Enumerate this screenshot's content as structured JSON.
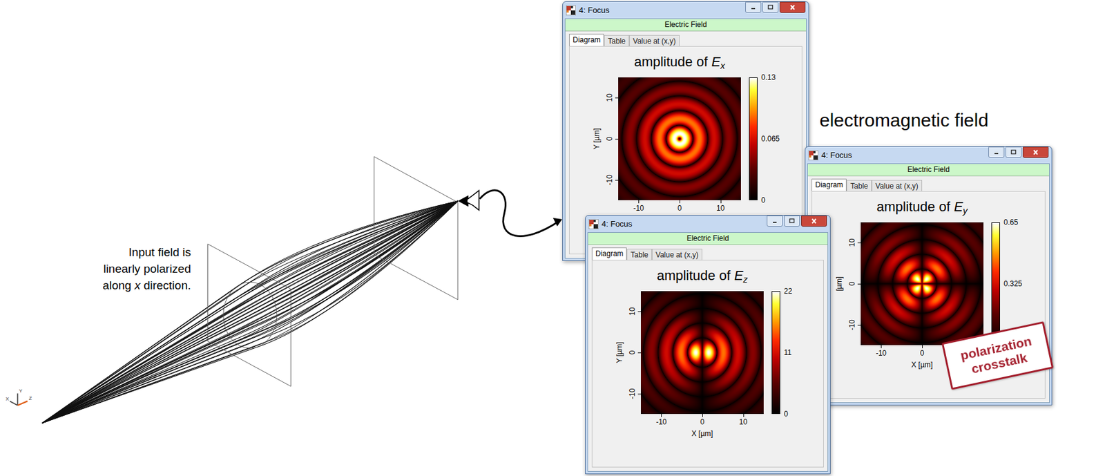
{
  "diagram": {
    "input_note": {
      "lines": [
        [
          {
            "text": "Input field is",
            "italic": false
          }
        ],
        [
          {
            "text": "linearly polarized",
            "italic": false
          }
        ],
        [
          {
            "text": "along ",
            "italic": false
          },
          {
            "text": "x",
            "italic": true
          },
          {
            "text": " direction.",
            "italic": false
          }
        ]
      ]
    },
    "axes": [
      "X",
      "Y",
      "Z"
    ]
  },
  "caption": "electromagnetic field",
  "windows": [
    {
      "title": "4: Focus",
      "header": "Electric Field",
      "tabs": [
        {
          "label": "Diagram",
          "selected": true
        },
        {
          "label": "Table",
          "selected": false
        },
        {
          "label": "Value at (x,y)",
          "selected": false
        }
      ],
      "plot": {
        "kind": "ex",
        "title": {
          "prefix": "amplitude of ",
          "symbol": "E",
          "subscript": "x"
        },
        "x_ticks": [
          "-10",
          "0",
          "10"
        ],
        "y_ticks": [
          "10",
          "0",
          "-10"
        ],
        "y_label": "Y [µm]",
        "colorbar": [
          "0.13",
          "0.065",
          "0"
        ]
      }
    },
    {
      "title": "4: Focus",
      "header": "Electric Field",
      "tabs": [
        {
          "label": "Diagram",
          "selected": true
        },
        {
          "label": "Table",
          "selected": false
        },
        {
          "label": "Value at (x,y)",
          "selected": false
        }
      ],
      "plot": {
        "kind": "ey",
        "title": {
          "prefix": "amplitude of ",
          "symbol": "E",
          "subscript": "y"
        },
        "x_ticks": [
          "-10",
          "0"
        ],
        "y_ticks": [
          "10",
          "0",
          "-10"
        ],
        "y_label": "[µm]",
        "x_label": "X [µm]",
        "colorbar": [
          "0.65",
          "0.325"
        ]
      }
    },
    {
      "title": "4: Focus",
      "header": "Electric Field",
      "tabs": [
        {
          "label": "Diagram",
          "selected": true
        },
        {
          "label": "Table",
          "selected": false
        },
        {
          "label": "Value at (x,y)",
          "selected": false
        }
      ],
      "plot": {
        "kind": "ez",
        "title": {
          "prefix": "amplitude of ",
          "symbol": "E",
          "subscript": "z"
        },
        "x_ticks": [
          "-10",
          "0",
          "10"
        ],
        "y_ticks": [
          "10",
          "0",
          "-10"
        ],
        "y_label": "Y [µm]",
        "x_label": "X [µm]",
        "colorbar": [
          "22",
          "11",
          "0"
        ]
      }
    }
  ],
  "badge": {
    "lines": [
      "polarization",
      "crosstalk"
    ]
  }
}
